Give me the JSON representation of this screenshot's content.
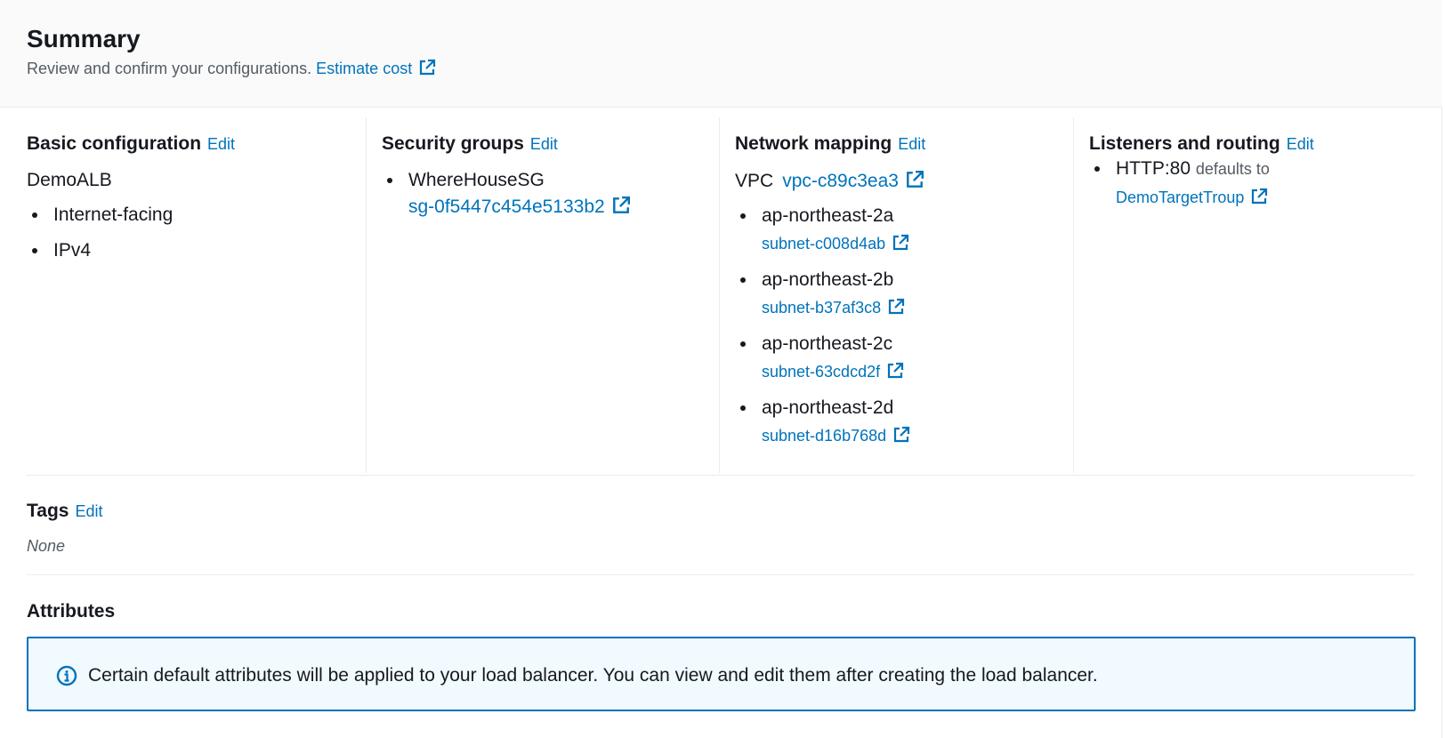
{
  "summary": {
    "title": "Summary",
    "description": "Review and confirm your configurations.",
    "estimate_cost_label": "Estimate cost"
  },
  "edit_label": "Edit",
  "basic_configuration": {
    "heading": "Basic configuration",
    "name": "DemoALB",
    "items": [
      "Internet-facing",
      "IPv4"
    ]
  },
  "security_groups": {
    "heading": "Security groups",
    "group_name": "WhereHouseSG",
    "group_id": "sg-0f5447c454e5133b2"
  },
  "network_mapping": {
    "heading": "Network mapping",
    "vpc_label": "VPC",
    "vpc_id": "vpc-c89c3ea3",
    "zones": [
      {
        "zone": "ap-northeast-2a",
        "subnet": "subnet-c008d4ab"
      },
      {
        "zone": "ap-northeast-2b",
        "subnet": "subnet-b37af3c8"
      },
      {
        "zone": "ap-northeast-2c",
        "subnet": "subnet-63cdcd2f"
      },
      {
        "zone": "ap-northeast-2d",
        "subnet": "subnet-d16b768d"
      }
    ]
  },
  "listeners_routing": {
    "heading": "Listeners and routing",
    "listener": "HTTP:80",
    "defaults_to_label": "defaults to",
    "target_group": "DemoTargetTroup"
  },
  "tags": {
    "heading": "Tags",
    "value": "None"
  },
  "attributes": {
    "heading": "Attributes",
    "info_message": "Certain default attributes will be applied to your load balancer. You can view and edit them after creating the load balancer."
  },
  "colors": {
    "link": "#0073bb",
    "text": "#16191f",
    "muted": "#545b64",
    "header_bg": "#fafafa",
    "alert_bg": "#f1faff",
    "alert_border": "#0073bb",
    "divider": "#eaeded"
  },
  "icons": {
    "external_link": "external-link-icon",
    "info": "info-icon"
  }
}
